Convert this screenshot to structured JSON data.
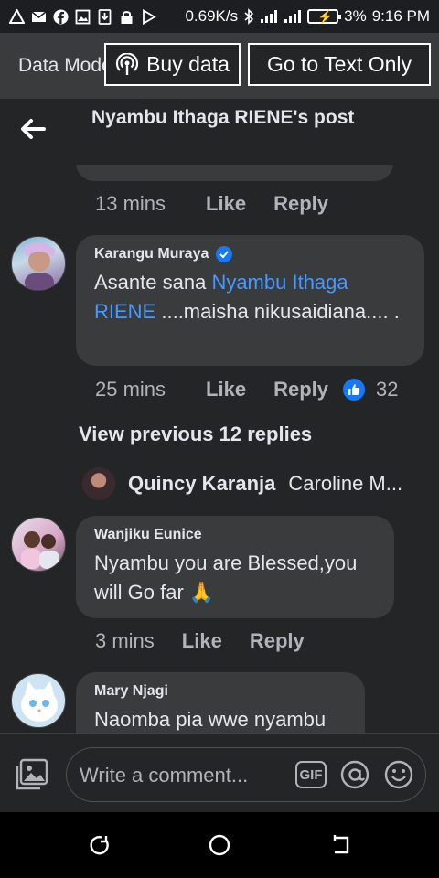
{
  "status_bar": {
    "net_speed": "0.69K/s",
    "battery": "3%",
    "time": "9:16 PM"
  },
  "data_banner": {
    "mode_label": "Data Mode",
    "buy_data_label": "Buy data",
    "text_only_label": "Go to Text Only"
  },
  "header": {
    "title": "Nyambu Ithaga RIENE's post"
  },
  "top_meta": {
    "time": "13 mins",
    "like_label": "Like",
    "reply_label": "Reply"
  },
  "comments": [
    {
      "author": "Karangu Muraya",
      "verified": true,
      "text_before": "Asante sana ",
      "mention": "Nyambu Ithaga RIENE",
      "text_after": " ....maisha nikusaidiana.... .",
      "time": "25 mins",
      "like_label": "Like",
      "reply_label": "Reply",
      "reaction_count": "32"
    },
    {
      "author": "Wanjiku Eunice",
      "text": "Nyambu you are Blessed,you will Go far 🙏",
      "time": "3 mins",
      "like_label": "Like",
      "reply_label": "Reply"
    },
    {
      "author": "Mary Njagi",
      "text": "Naomba pia wwe nyambu"
    }
  ],
  "view_previous": "View previous 12 replies",
  "reply_preview": {
    "name": "Quincy Karanja",
    "text": "Caroline M..."
  },
  "composer": {
    "placeholder": "Write a comment...",
    "gif_label": "GIF"
  },
  "colors": {
    "background": "#242526",
    "bubble": "#3a3b3c",
    "mention": "#4599ff",
    "accent": "#1877f2"
  }
}
